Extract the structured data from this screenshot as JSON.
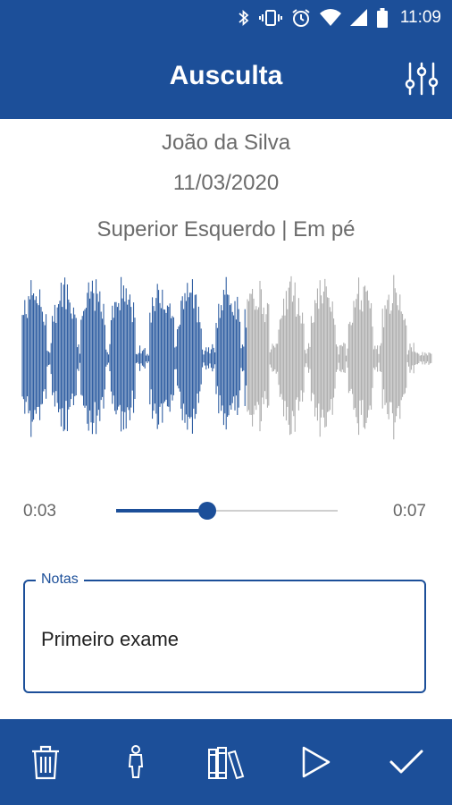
{
  "status_bar": {
    "time": "11:09",
    "icons": [
      "bluetooth-icon",
      "vibrate-icon",
      "alarm-icon",
      "wifi-icon",
      "signal-icon",
      "battery-icon"
    ]
  },
  "app_bar": {
    "title": "Ausculta",
    "action_icon": "filter-sliders-icon"
  },
  "recording": {
    "patient_name": "João da Silva",
    "date": "11/03/2020",
    "location": "Superior Esquerdo | Em pé"
  },
  "playback": {
    "current_time": "0:03",
    "total_time": "0:07",
    "progress": 0.41,
    "played_color": "#1c4f99",
    "unplayed_color": "#a8a8a8"
  },
  "notes": {
    "label": "Notas",
    "value": "Primeiro exame"
  },
  "bottom_bar": {
    "icons": [
      "trash-icon",
      "person-icon",
      "books-icon",
      "play-icon",
      "check-icon"
    ]
  },
  "colors": {
    "primary": "#1c4f99",
    "background": "#ffffff",
    "text_secondary": "#6b6b6b"
  }
}
